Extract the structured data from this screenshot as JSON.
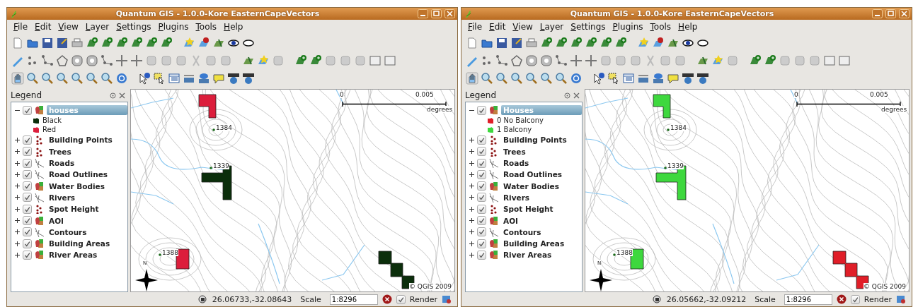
{
  "windows": [
    {
      "title": "Quantum GIS - 1.0.0-Kore  EasternCapeVectors",
      "menu": [
        "File",
        "Edit",
        "View",
        "Layer",
        "Settings",
        "Plugins",
        "Tools",
        "Help"
      ],
      "legend": {
        "title": "Legend",
        "layers": [
          {
            "name": "houses",
            "kind": "polygon",
            "checked": true,
            "expanded": true,
            "selected": true,
            "children": [
              {
                "label": "Black",
                "color": "#0b2e0b"
              },
              {
                "label": "Red",
                "color": "#dc1e3c"
              }
            ]
          },
          {
            "name": "Building Points",
            "kind": "point",
            "checked": true,
            "expanded": false,
            "selected": false
          },
          {
            "name": "Trees",
            "kind": "point",
            "checked": true,
            "expanded": false,
            "selected": false
          },
          {
            "name": "Roads",
            "kind": "line",
            "checked": true,
            "expanded": false,
            "selected": false
          },
          {
            "name": "Road Outlines",
            "kind": "line",
            "checked": true,
            "expanded": false,
            "selected": false
          },
          {
            "name": "Water Bodies",
            "kind": "polygon",
            "checked": true,
            "expanded": false,
            "selected": false
          },
          {
            "name": "Rivers",
            "kind": "line",
            "checked": true,
            "expanded": false,
            "selected": false
          },
          {
            "name": "Spot Height",
            "kind": "point",
            "checked": true,
            "expanded": false,
            "selected": false
          },
          {
            "name": "AOI",
            "kind": "polygon",
            "checked": true,
            "expanded": false,
            "selected": false
          },
          {
            "name": "Contours",
            "kind": "line",
            "checked": true,
            "expanded": false,
            "selected": false
          },
          {
            "name": "Building Areas",
            "kind": "polygon",
            "checked": true,
            "expanded": false,
            "selected": false
          },
          {
            "name": "River Areas",
            "kind": "polygon",
            "checked": true,
            "expanded": false,
            "selected": false
          }
        ]
      },
      "map": {
        "scale_labels": [
          "0",
          "0.005",
          "degrees"
        ],
        "north": "N",
        "spot_heights": [
          "1384",
          "1339",
          "1388"
        ],
        "houses": [
          {
            "color": "#dc1e3c"
          },
          {
            "color": "#0b2e0b"
          },
          {
            "color": "#dc1e3c"
          },
          {
            "color": "#0b2e0b"
          }
        ],
        "copyright": "© QGIS 2009"
      },
      "status_bar": {
        "coordinates": "26.06733,-32.08643",
        "scale_label": "Scale",
        "scale_value": "1:8296",
        "render_checked": true,
        "render_label": "Render"
      }
    },
    {
      "title": "Quantum GIS - 1.0.0-Kore  EasternCapeVectors",
      "menu": [
        "File",
        "Edit",
        "View",
        "Layer",
        "Settings",
        "Plugins",
        "Tools",
        "Help"
      ],
      "legend": {
        "title": "Legend",
        "layers": [
          {
            "name": "Houses",
            "kind": "polygon",
            "checked": true,
            "expanded": true,
            "selected": true,
            "children": [
              {
                "label": "0 No Balcony",
                "color": "#e01e28"
              },
              {
                "label": "1 Balcony",
                "color": "#3ed83e"
              }
            ]
          },
          {
            "name": "Building Points",
            "kind": "point",
            "checked": true,
            "expanded": false,
            "selected": false
          },
          {
            "name": "Trees",
            "kind": "point",
            "checked": true,
            "expanded": false,
            "selected": false
          },
          {
            "name": "Roads",
            "kind": "line",
            "checked": true,
            "expanded": false,
            "selected": false
          },
          {
            "name": "Road Outlines",
            "kind": "line",
            "checked": true,
            "expanded": false,
            "selected": false
          },
          {
            "name": "Water Bodies",
            "kind": "polygon",
            "checked": true,
            "expanded": false,
            "selected": false
          },
          {
            "name": "Rivers",
            "kind": "line",
            "checked": true,
            "expanded": false,
            "selected": false
          },
          {
            "name": "Spot Height",
            "kind": "point",
            "checked": true,
            "expanded": false,
            "selected": false
          },
          {
            "name": "AOI",
            "kind": "polygon",
            "checked": true,
            "expanded": false,
            "selected": false
          },
          {
            "name": "Contours",
            "kind": "line",
            "checked": true,
            "expanded": false,
            "selected": false
          },
          {
            "name": "Building Areas",
            "kind": "polygon",
            "checked": true,
            "expanded": false,
            "selected": false
          },
          {
            "name": "River Areas",
            "kind": "polygon",
            "checked": true,
            "expanded": false,
            "selected": false
          }
        ]
      },
      "map": {
        "scale_labels": [
          "0",
          "0.005",
          "degrees"
        ],
        "north": "N",
        "spot_heights": [
          "1384",
          "1339",
          "1388"
        ],
        "houses": [
          {
            "color": "#3ed83e"
          },
          {
            "color": "#3ed83e"
          },
          {
            "color": "#3ed83e"
          },
          {
            "color": "#e01e28"
          }
        ],
        "copyright": "© QGIS 2009"
      },
      "status_bar": {
        "coordinates": "26.05662,-32.09212",
        "scale_label": "Scale",
        "scale_value": "1:8296",
        "render_checked": true,
        "render_label": "Render"
      }
    }
  ]
}
